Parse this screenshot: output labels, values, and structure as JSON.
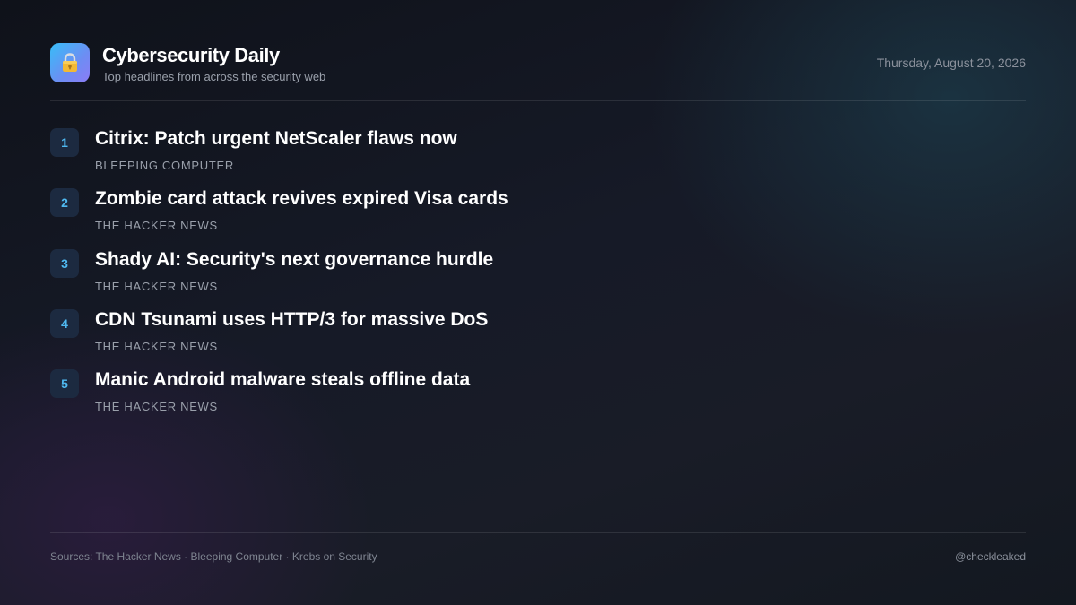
{
  "header": {
    "logo_icon": "lock-icon",
    "title": "Cybersecurity Daily",
    "subtitle": "Top headlines from across the security web",
    "date": "Thursday, August 20, 2026"
  },
  "headlines": [
    {
      "rank": "1",
      "title": "Citrix: Patch urgent NetScaler flaws now",
      "source": "BLEEPING COMPUTER"
    },
    {
      "rank": "2",
      "title": "Zombie card attack revives expired Visa cards",
      "source": "THE HACKER NEWS"
    },
    {
      "rank": "3",
      "title": "Shady AI: Security's next governance hurdle",
      "source": "THE HACKER NEWS"
    },
    {
      "rank": "4",
      "title": "CDN Tsunami uses HTTP/3 for massive DoS",
      "source": "THE HACKER NEWS"
    },
    {
      "rank": "5",
      "title": "Manic Android malware steals offline data",
      "source": "THE HACKER NEWS"
    }
  ],
  "footer": {
    "sources": "Sources: The Hacker News · Bleeping Computer · Krebs on Security",
    "handle": "@checkleaked"
  },
  "colors": {
    "accent": "#4fb9f0",
    "rank_badge_bg": "#1c2a40",
    "muted_text": "#9aa0ab"
  }
}
